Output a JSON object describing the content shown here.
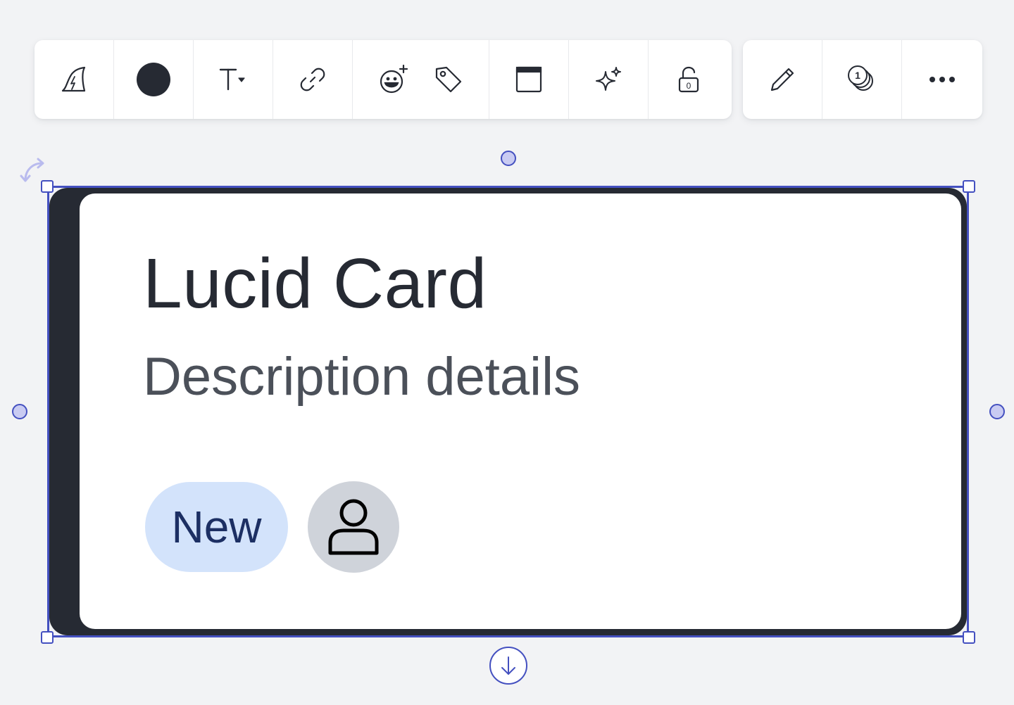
{
  "toolbar": {
    "main_icons": [
      "lucid-wizard-icon",
      "fill-color-swatch",
      "text-format-icon",
      "link-icon",
      "add-reaction-icon",
      "tag-icon",
      "container-icon",
      "ai-sparkle-icon",
      "unlock-icon"
    ],
    "secondary_icons": [
      "pencil-icon",
      "stacked-coins-icon",
      "more-icon"
    ],
    "fill_color": "#262a33",
    "text_icon_label": "T",
    "lock_count": "0",
    "coin_count": "1"
  },
  "card": {
    "title": "Lucid Card",
    "description": "Description details",
    "badge_label": "New",
    "border_color": "#262a33",
    "badge_color": "#d3e3fb"
  },
  "selection": {
    "color": "#4450c0"
  }
}
